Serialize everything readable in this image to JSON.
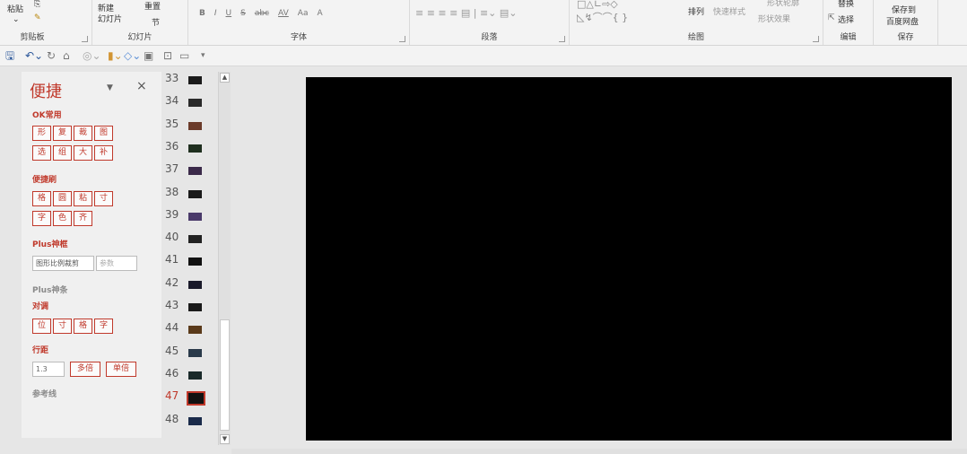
{
  "ribbon": {
    "clipboard": {
      "paste_label": "粘贴",
      "group_label": "剪贴板"
    },
    "slides": {
      "new_slide_label": "新建\n幻灯片",
      "reset_label": "重置",
      "section_label": "节",
      "group_label": "幻灯片"
    },
    "font": {
      "buttons": [
        "B",
        "I",
        "U",
        "S",
        "abc",
        "AV",
        "Aa",
        "A"
      ],
      "group_label": "字体"
    },
    "paragraph": {
      "group_label": "段落"
    },
    "drawing": {
      "arrange_label": "排列",
      "quick_styles_label": "快速样式",
      "shape_outline_label": "形状轮廓",
      "shape_effects_label": "形状效果",
      "group_label": "绘图"
    },
    "editing": {
      "replace_label": "替换",
      "select_label": "选择",
      "group_label": "编辑"
    },
    "save": {
      "save_to_label": "保存到",
      "baidu_label": "百度网盘",
      "group_label": "保存"
    }
  },
  "panel": {
    "title": "便捷",
    "close": "×",
    "dropdown": "▼",
    "sections": [
      {
        "label": "OK常用",
        "rows": [
          [
            "形",
            "复",
            "裁",
            "图"
          ],
          [
            "选",
            "组",
            "大",
            "补"
          ]
        ]
      },
      {
        "label": "便捷刷",
        "rows": [
          [
            "格",
            "圆",
            "粘",
            "寸"
          ],
          [
            "字",
            "色",
            "齐"
          ]
        ]
      },
      {
        "label": "Plus神框",
        "input_value": "图形比例裁剪",
        "input_placeholder": "参数"
      },
      {
        "label": "Plus神条"
      },
      {
        "label": "对调",
        "rows": [
          [
            "位",
            "寸",
            "格",
            "字"
          ]
        ]
      },
      {
        "label": "行距",
        "input_value": "1.3",
        "buttons": [
          "多倍",
          "单倍"
        ]
      },
      {
        "label": "参考线"
      }
    ]
  },
  "thumbnails": {
    "numbers": [
      "33",
      "34",
      "35",
      "36",
      "37",
      "38",
      "39",
      "40",
      "41",
      "42",
      "43",
      "44",
      "45",
      "46",
      "47",
      "48"
    ],
    "selected": "47"
  },
  "colors": {
    "accent": "#c0392b",
    "slide_bg": "#000000"
  }
}
